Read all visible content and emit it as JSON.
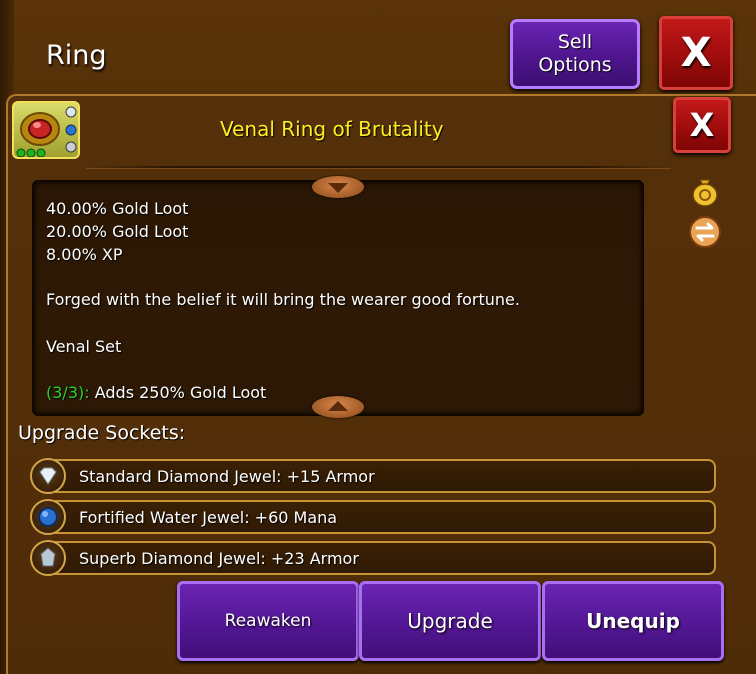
{
  "screen": {
    "title": "Ring"
  },
  "buttons": {
    "sell_options": "Sell\nOptions",
    "close_top": "X",
    "close_inner": "X"
  },
  "item": {
    "name": "Venal Ring of Brutality",
    "name_color": "#ffee1f",
    "stats": [
      "40.00% Gold Loot",
      "20.00% Gold Loot",
      "8.00% XP"
    ],
    "flavor": "Forged with the belief it will bring the wearer good fortune.",
    "set_name": "Venal Set",
    "set_bonus_count": "(3/3):",
    "set_bonus_text": " Adds 250% Gold Loot"
  },
  "upgrade_sockets": {
    "label": "Upgrade Sockets:",
    "items": [
      {
        "text": "Standard Diamond Jewel: +15 Armor",
        "icon": "diamond-jewel-icon"
      },
      {
        "text": "Fortified Water Jewel: +60 Mana",
        "icon": "water-jewel-icon"
      },
      {
        "text": "Superb Diamond Jewel: +23 Armor",
        "icon": "diamond-jewel-icon"
      }
    ]
  },
  "actions": {
    "reawaken": "Reawaken",
    "upgrade": "Upgrade",
    "unequip": "Unequip"
  }
}
